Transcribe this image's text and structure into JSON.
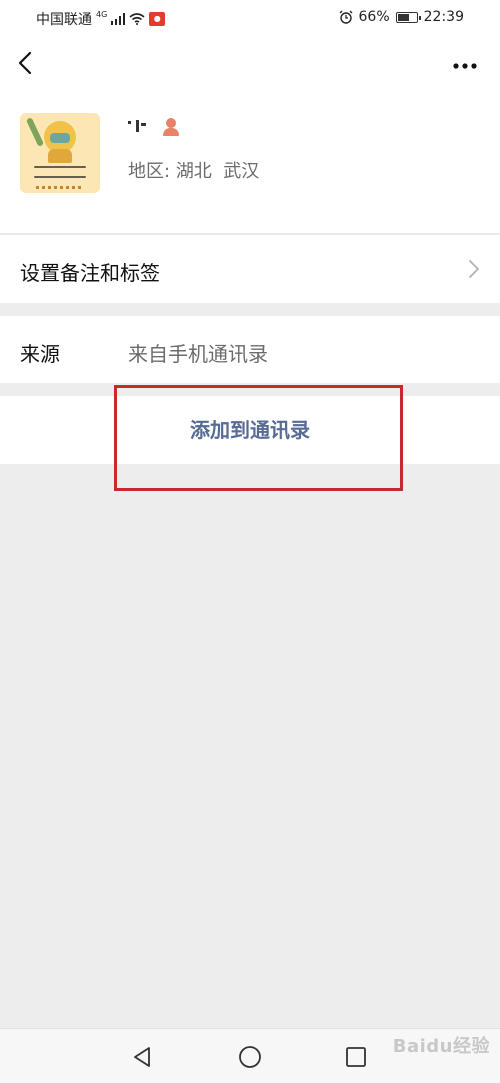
{
  "status_bar": {
    "carrier": "中国联通",
    "network": "4G",
    "battery_percent": "66%",
    "battery_level": 0.66,
    "time": "22:39"
  },
  "profile": {
    "region_label": "地区:",
    "region_value": "湖北  武汉"
  },
  "rows": {
    "remark_label": "设置备注和标签",
    "source_label": "来源",
    "source_value": "来自手机通讯录"
  },
  "actions": {
    "add_contact_label": "添加到通讯录"
  },
  "watermark": {
    "text": "Baidu经验"
  },
  "colors": {
    "accent": "#576b95",
    "highlight": "#c9282d",
    "background": "#ededed"
  },
  "icons": [
    "back-icon",
    "more-icon",
    "chevron-right-icon",
    "gender-female-icon",
    "nav-back-icon",
    "nav-home-icon",
    "nav-recent-icon",
    "wifi-icon",
    "signal-icon",
    "alarm-icon",
    "battery-icon"
  ]
}
